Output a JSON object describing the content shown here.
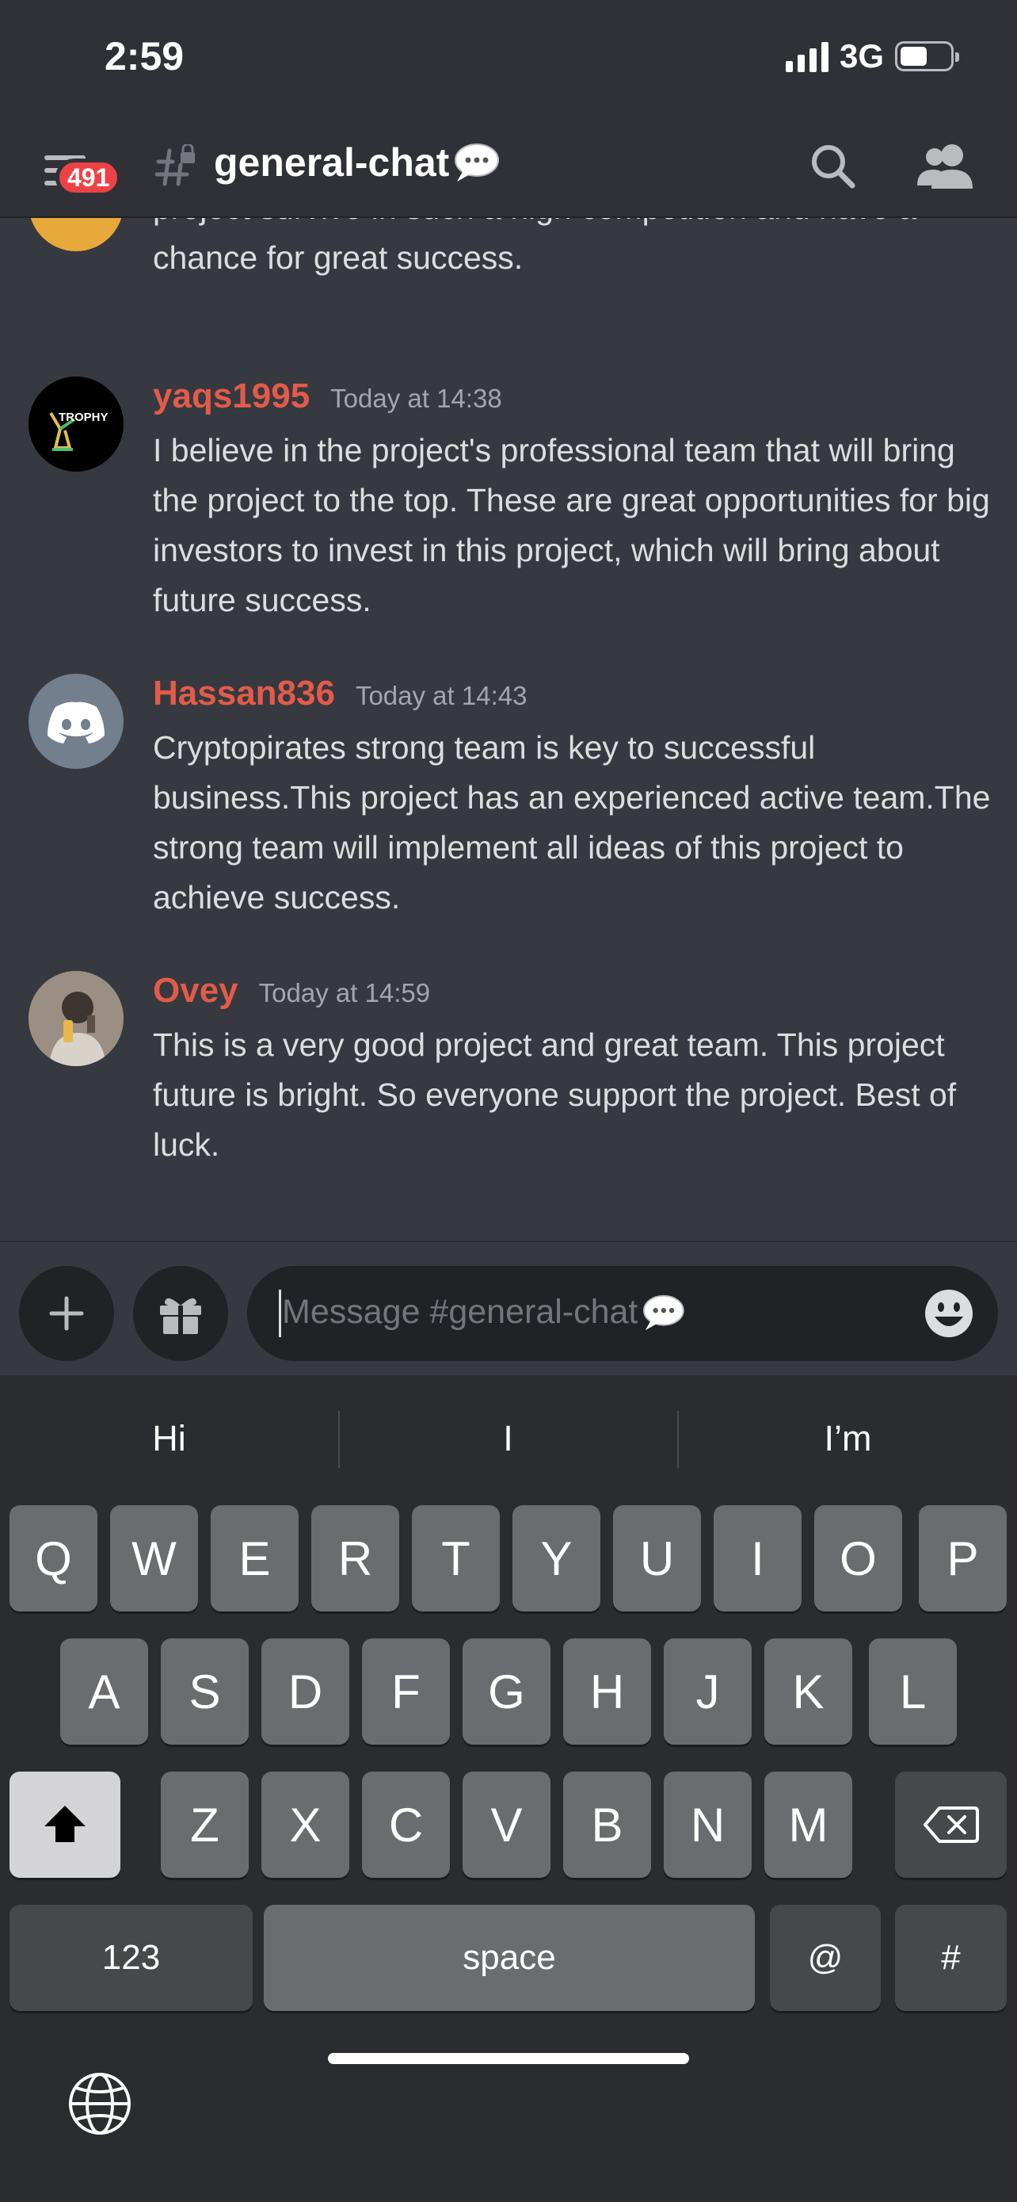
{
  "status_bar": {
    "time": "2:59",
    "network": "3G",
    "battery_level": 0.55
  },
  "header": {
    "badge_count": "491",
    "channel_name": "general-chat",
    "channel_emoji": "speech-balloon-icon"
  },
  "messages": {
    "partial_text": "project survive in such a high competition and have a chance for great success.",
    "items": [
      {
        "author": "yaqs1995",
        "timestamp": "Today at 14:38",
        "avatar_label": "TROPHY",
        "text": "I believe in the project's professional team that will bring the project to the top. These are great opportunities for big investors to invest in this project, which will bring about future success."
      },
      {
        "author": "Hassan836",
        "timestamp": "Today at 14:43",
        "text": "Cryptopirates strong team is key to successful business.This project has an experienced active team.The strong team will implement all ideas of this project to achieve success."
      },
      {
        "author": "Ovey",
        "timestamp": "Today at 14:59",
        "text": "This is a very good project and great team. This project future is bright. So everyone support the project. Best of luck."
      }
    ]
  },
  "composer": {
    "placeholder": "Message #general-chat"
  },
  "keyboard": {
    "suggestions": [
      "Hi",
      "I",
      "I’m"
    ],
    "row1": [
      "Q",
      "W",
      "E",
      "R",
      "T",
      "Y",
      "U",
      "I",
      "O",
      "P"
    ],
    "row2": [
      "A",
      "S",
      "D",
      "F",
      "G",
      "H",
      "J",
      "K",
      "L"
    ],
    "row3": [
      "Z",
      "X",
      "C",
      "V",
      "B",
      "N",
      "M"
    ],
    "numbers_key": "123",
    "space_key": "space",
    "at_key": "@",
    "hash_key": "#"
  },
  "colors": {
    "author": "#e25b4a",
    "badge": "#ed4245",
    "background": "#36393f"
  }
}
